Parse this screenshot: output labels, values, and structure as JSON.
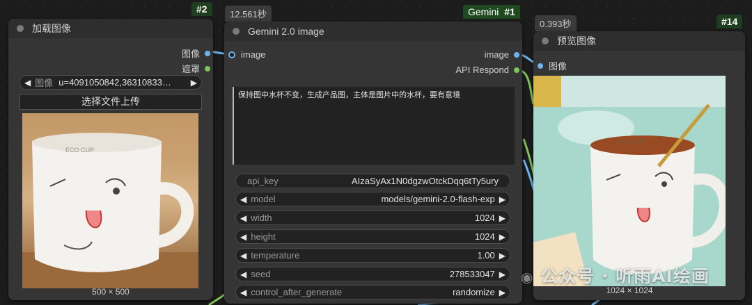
{
  "node_load_image": {
    "id": "#2",
    "title": "加载图像",
    "outputs": [
      "图像",
      "遮罩"
    ],
    "image_widget": {
      "label": "图像",
      "value": "u=4091050842,36310833…"
    },
    "upload_label": "选择文件上传",
    "image_size": "500 × 500"
  },
  "node_gemini": {
    "id": "#1",
    "id_tag": "Gemini",
    "time": "12.561秒",
    "title": "Gemini 2.0 image",
    "input": "image",
    "outputs": [
      "image",
      "API Respond"
    ],
    "prompt": "保持图中水杯不变，生成产品图，主体是图片中的水杯，要有意境",
    "widgets": [
      {
        "label": "api_key",
        "value": "AIzaSyAx1N0dgzwOtckDqq6tTy5ury",
        "arrows": false
      },
      {
        "label": "model",
        "value": "models/gemini-2.0-flash-exp",
        "arrows": true
      },
      {
        "label": "width",
        "value": "1024",
        "arrows": true
      },
      {
        "label": "height",
        "value": "1024",
        "arrows": true
      },
      {
        "label": "temperature",
        "value": "1.00",
        "arrows": true
      },
      {
        "label": "seed",
        "value": "278533047",
        "arrows": true
      },
      {
        "label": "control_after_generate",
        "value": "randomize",
        "arrows": true
      }
    ]
  },
  "node_preview": {
    "id": "#14",
    "time": "0.393秒",
    "title": "预览图像",
    "input": "图像",
    "image_size": "1024 × 1024",
    "cup_text": "ECO CUP"
  },
  "watermark": "公众号 · 听雨AI绘画",
  "cup_text_small": "ECO CUP",
  "colors": {
    "image_slot": "#6cb4f0",
    "mask_slot": "#7fc45a",
    "badge": "#1f3d1f"
  }
}
